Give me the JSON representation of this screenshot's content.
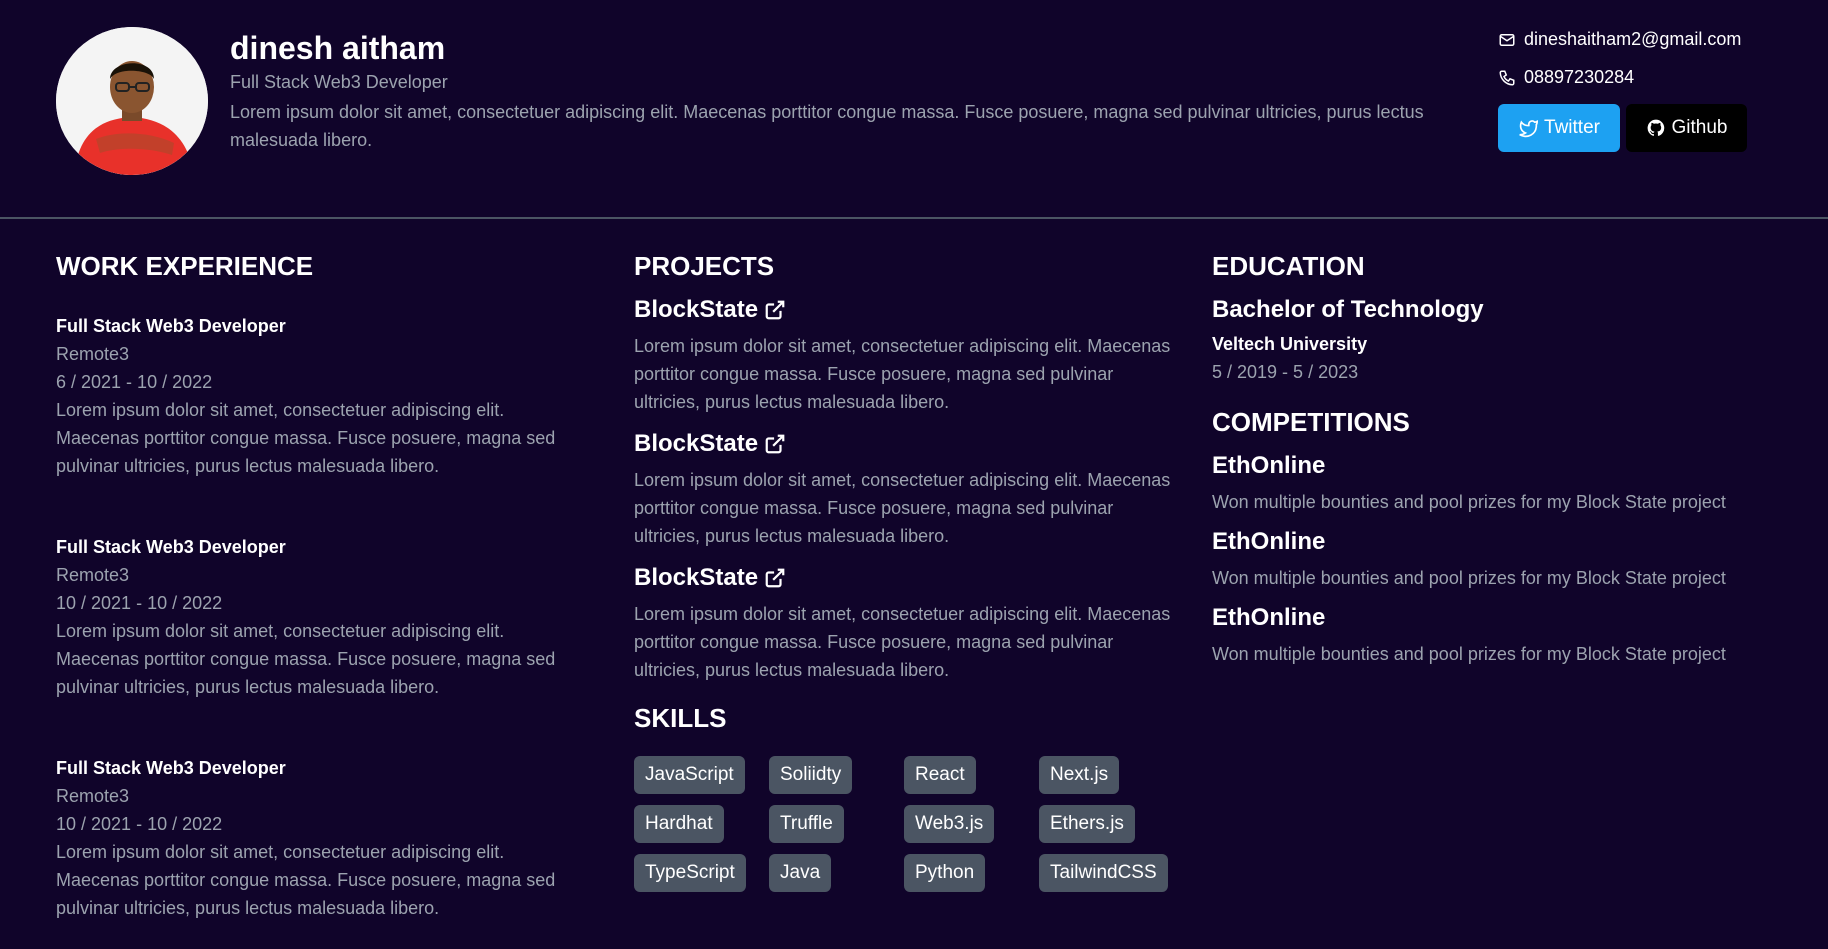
{
  "profile": {
    "name": "dinesh aitham",
    "role": "Full Stack Web3 Developer",
    "bio": "Lorem ipsum dolor sit amet, consectetuer adipiscing elit. Maecenas porttitor congue massa. Fusce posuere, magna sed pulvinar ultricies, purus lectus malesuada libero.",
    "email": "dineshaitham2@gmail.com",
    "phone": "08897230284",
    "twitter_label": "Twitter",
    "github_label": "Github"
  },
  "work": {
    "title": "WORK EXPERIENCE",
    "jobs": [
      {
        "title": "Full Stack Web3 Developer",
        "company": "Remote3",
        "dates": "6 / 2021 - 10 / 2022",
        "desc": "Lorem ipsum dolor sit amet, consectetuer adipiscing elit. Maecenas porttitor congue massa. Fusce posuere, magna sed pulvinar ultricies, purus lectus malesuada libero."
      },
      {
        "title": "Full Stack Web3 Developer",
        "company": "Remote3",
        "dates": "10 / 2021 - 10 / 2022",
        "desc": "Lorem ipsum dolor sit amet, consectetuer adipiscing elit. Maecenas porttitor congue massa. Fusce posuere, magna sed pulvinar ultricies, purus lectus malesuada libero."
      },
      {
        "title": "Full Stack Web3 Developer",
        "company": "Remote3",
        "dates": "10 / 2021 - 10 / 2022",
        "desc": "Lorem ipsum dolor sit amet, consectetuer adipiscing elit. Maecenas porttitor congue massa. Fusce posuere, magna sed pulvinar ultricies, purus lectus malesuada libero."
      }
    ]
  },
  "projects": {
    "title": "PROJECTS",
    "items": [
      {
        "name": "BlockState",
        "desc": "Lorem ipsum dolor sit amet, consectetuer adipiscing elit. Maecenas porttitor congue massa. Fusce posuere, magna sed pulvinar ultricies, purus lectus malesuada libero."
      },
      {
        "name": "BlockState",
        "desc": "Lorem ipsum dolor sit amet, consectetuer adipiscing elit. Maecenas porttitor congue massa. Fusce posuere, magna sed pulvinar ultricies, purus lectus malesuada libero."
      },
      {
        "name": "BlockState",
        "desc": "Lorem ipsum dolor sit amet, consectetuer adipiscing elit. Maecenas porttitor congue massa. Fusce posuere, magna sed pulvinar ultricies, purus lectus malesuada libero."
      }
    ]
  },
  "skills": {
    "title": "SKILLS",
    "items": [
      "JavaScript",
      "Soliidty",
      "React",
      "Next.js",
      "Hardhat",
      "Truffle",
      "Web3.js",
      "Ethers.js",
      "TypeScript",
      "Java",
      "Python",
      "TailwindCSS"
    ]
  },
  "education": {
    "title": "EDUCATION",
    "degree": "Bachelor of Technology",
    "school": "Veltech University",
    "dates": "5 / 2019 - 5 / 2023"
  },
  "competitions": {
    "title": "COMPETITIONS",
    "items": [
      {
        "name": "EthOnline",
        "desc": "Won multiple bounties and pool prizes for my Block State project"
      },
      {
        "name": "EthOnline",
        "desc": "Won multiple bounties and pool prizes for my Block State project"
      },
      {
        "name": "EthOnline",
        "desc": "Won multiple bounties and pool prizes for my Block State project"
      }
    ]
  },
  "colors": {
    "background": "#10042a",
    "twitter": "#1da1f2",
    "github": "#000000",
    "chip": "#4b5563",
    "muted": "#9ca3af"
  },
  "icons": [
    "mail-icon",
    "phone-icon",
    "twitter-bird-icon",
    "github-icon",
    "external-link-icon"
  ]
}
